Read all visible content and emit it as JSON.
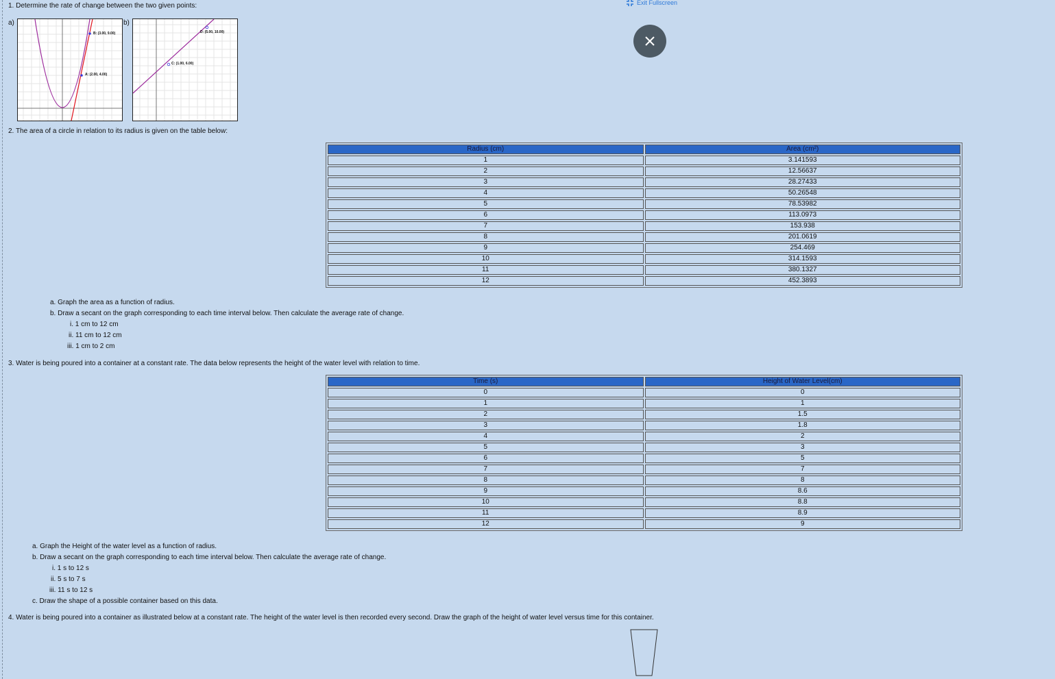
{
  "q1": {
    "prompt": "1.  Determine the rate of change between the two given points:",
    "label_a": "a)",
    "label_b": "b)",
    "point_A": "A: (2.00, 4.00)",
    "point_B": "B: (3.00, 9.00)",
    "point_C": "C: (1.00, 6.00)",
    "point_D": "D: (5.00, 10.00)"
  },
  "toolbar": {
    "exit_fullscreen": "Exit Fullscreen"
  },
  "q2": {
    "prompt": "2.  The area of a circle in relation to its radius is given on the table below:",
    "headers": [
      "Radius (cm)",
      "Area (cm²)"
    ],
    "rows": [
      [
        "1",
        "3.141593"
      ],
      [
        "2",
        "12.56637"
      ],
      [
        "3",
        "28.27433"
      ],
      [
        "4",
        "50.26548"
      ],
      [
        "5",
        "78.53982"
      ],
      [
        "6",
        "113.0973"
      ],
      [
        "7",
        "153.938"
      ],
      [
        "8",
        "201.0619"
      ],
      [
        "9",
        "254.469"
      ],
      [
        "10",
        "314.1593"
      ],
      [
        "11",
        "380.1327"
      ],
      [
        "12",
        "452.3893"
      ]
    ],
    "sub_a": "a.  Graph the area as a function of radius.",
    "sub_b": "b.  Draw a secant on the graph corresponding to each time interval below. Then calculate the average rate of change.",
    "sub_b_i": "i.  1 cm to 12 cm",
    "sub_b_ii": "ii.  11 cm to 12 cm",
    "sub_b_iii": "iii.  1 cm to 2 cm"
  },
  "q3": {
    "prompt": "3.  Water is being poured into a container at a constant rate. The data below represents the height of the water level with relation to time.",
    "headers": [
      "Time (s)",
      "Height of Water Level(cm)"
    ],
    "rows": [
      [
        "0",
        "0"
      ],
      [
        "1",
        "1"
      ],
      [
        "2",
        "1.5"
      ],
      [
        "3",
        "1.8"
      ],
      [
        "4",
        "2"
      ],
      [
        "5",
        "3"
      ],
      [
        "6",
        "5"
      ],
      [
        "7",
        "7"
      ],
      [
        "8",
        "8"
      ],
      [
        "9",
        "8.6"
      ],
      [
        "10",
        "8.8"
      ],
      [
        "11",
        "8.9"
      ],
      [
        "12",
        "9"
      ]
    ],
    "sub_a": "a.  Graph the Height of the water level as a function of radius.",
    "sub_b": "b.  Draw a secant on the graph corresponding to each time interval below. Then calculate the average rate of change.",
    "sub_b_i": "i.  1 s to 12 s",
    "sub_b_ii": "ii.  5 s to 7 s",
    "sub_b_iii": "iii.  11 s to 12 s",
    "sub_c": "c.  Draw the shape of a possible container based on this data."
  },
  "q4": {
    "prompt": "4.  Water is being poured into a container as illustrated below at a constant rate. The height of the water level is then recorded every second. Draw the graph of the height of water level versus time for this container."
  },
  "colors": {
    "background": "#c6d9ee",
    "table_header": "#2a67c7",
    "curve": "#9c2a9c",
    "secant": "#e0101a",
    "close_button": "#4d5a64"
  }
}
